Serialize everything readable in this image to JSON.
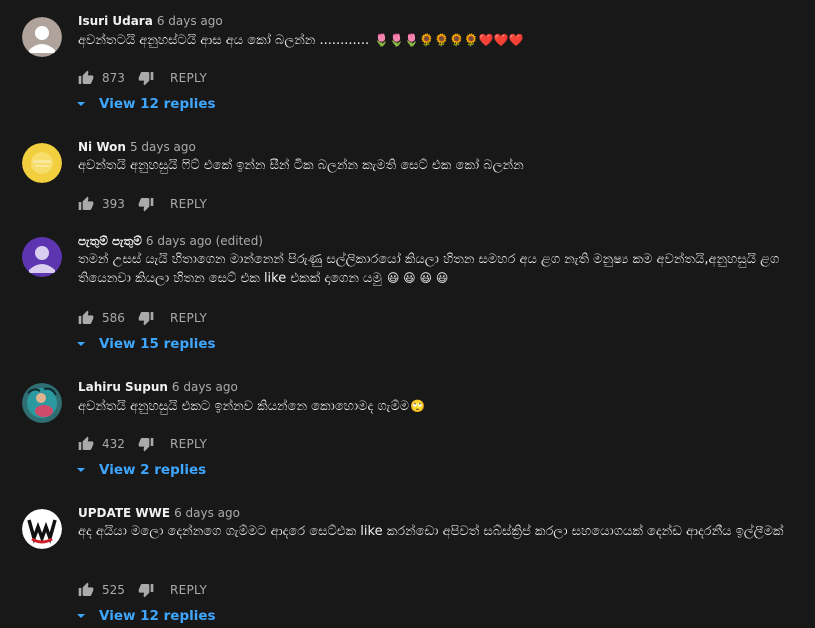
{
  "comments": [
    {
      "author": "Isuri Udara",
      "time": "6 days ago",
      "text": "අවන්තටයි අනුහස්ටයි ආස අය කෝ බලන්න ............",
      "emoji": "🌷🌷🌷🌻🌻🌻🌻❤️❤️❤️",
      "likes": "873",
      "reply_label": "REPLY",
      "view_replies": "View 12 replies",
      "avatar": "default-avatar-icon"
    },
    {
      "author": "Ni Won",
      "time": "5 days ago",
      "text": "අවන්තයි අනුහසුයි ෆිට් එකේ ඉන්න සීන් ටික බලන්න කැමති සෙට් එක කෝ බලන්න",
      "emoji": "",
      "likes": "393",
      "reply_label": "REPLY",
      "view_replies": "",
      "avatar": "yellow-logo-avatar"
    },
    {
      "author": "පැතුම් පැතුම්",
      "time": "6 days ago (edited)",
      "text": "තමන් උසස් යැයි හිතාගෙන මාන්නෙන් පිරුණු සල්ලිකාරයෝ කියලා හිතන සමහර අය ළග නැති මනුෂ්‍ය කම අවන්තයි,අනුහසුයි ළග තියෙනවා කියලා හිතන සෙට් එක like එකක් දාගෙන යමු",
      "emoji": "😃 😃 😃 😃",
      "likes": "586",
      "reply_label": "REPLY",
      "view_replies": "View 15 replies",
      "avatar": "default-avatar-icon"
    },
    {
      "author": "Lahiru Supun",
      "time": "6 days ago",
      "text": "අවන්තයි අනුහසුයි එකට ඉන්නව කියන්නෙ කොහොමද ගැම්ම",
      "emoji": "🙄",
      "likes": "432",
      "reply_label": "REPLY",
      "view_replies": "View 2 replies",
      "avatar": "photo-avatar"
    },
    {
      "author": "UPDATE WWE",
      "time": "6 days ago",
      "text": "අද අයියා මලො දෙන්නගෙ ගැම්මට ආදරෙ සෙට්එක like කරන්ඩො   අපිවත් සබ්ස්ක්‍රිප් කරලා සහයොගයක් දෙන්ඩ ආදරනීය ඉල්ලීමක්",
      "emoji": "",
      "likes": "525",
      "reply_label": "REPLY",
      "view_replies": "View 12 replies",
      "avatar": "wwe-logo-avatar"
    }
  ],
  "colors": {
    "background": "#181818",
    "text": "#f1f1f1",
    "secondary": "#aaaaaa",
    "link": "#3ea6ff"
  }
}
